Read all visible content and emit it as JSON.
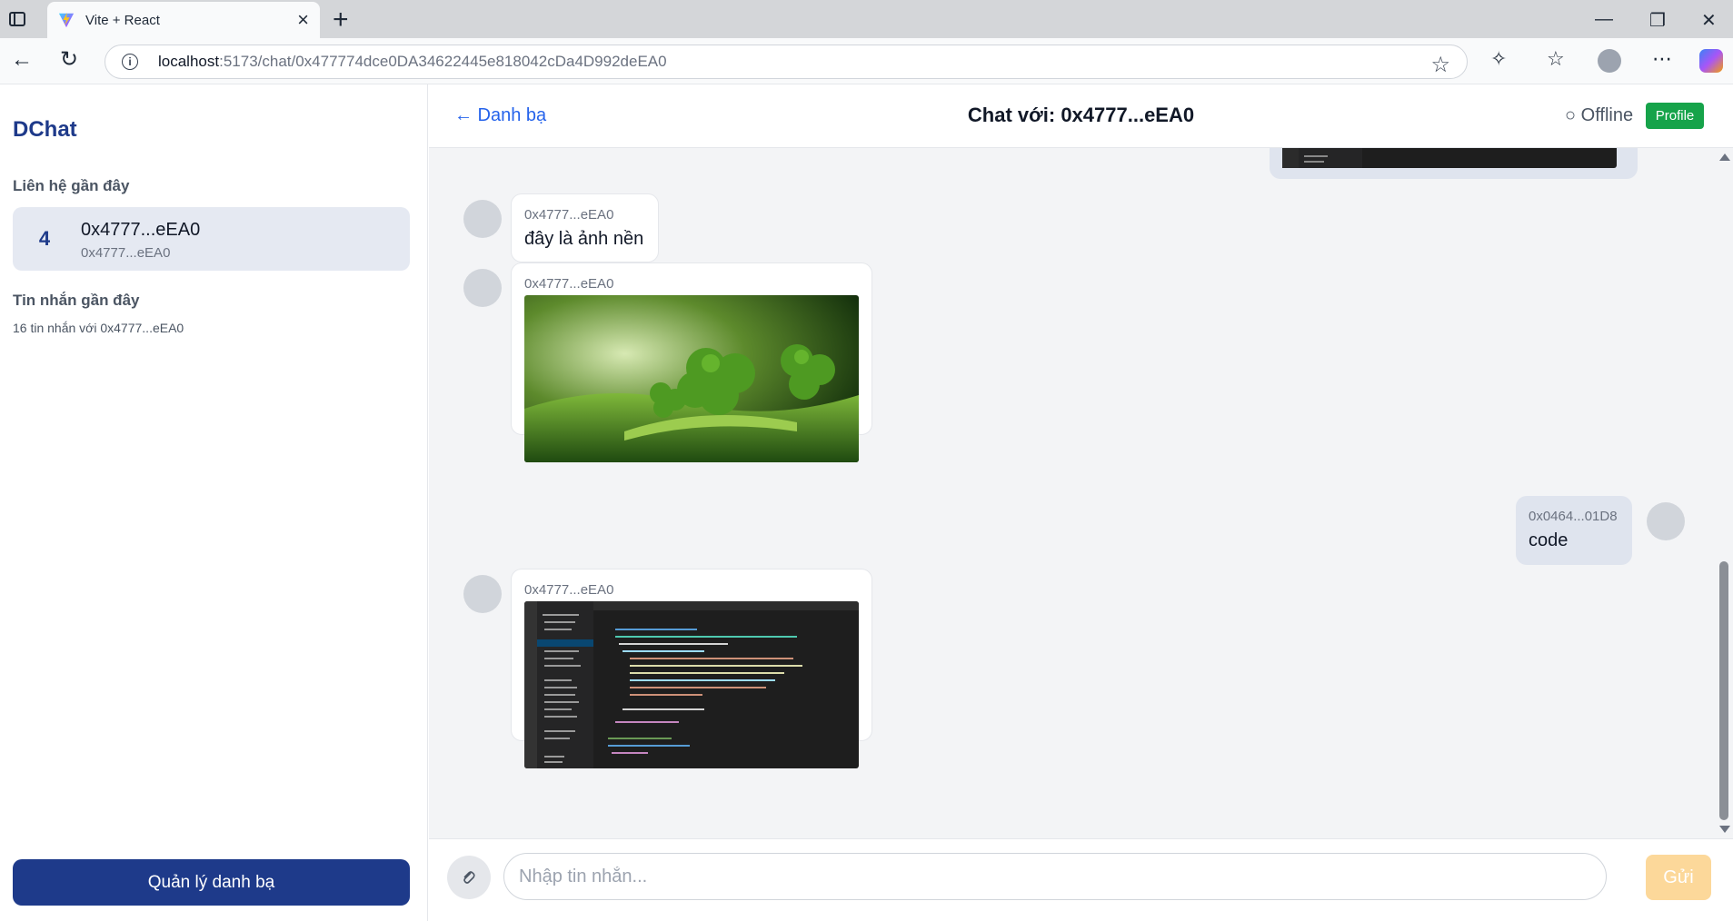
{
  "browser": {
    "tab_title": "Vite + React",
    "url_host": "localhost",
    "url_rest": ":5173/chat/0x477774dce0DA34622445e818042cDa4D992deEA0"
  },
  "sidebar": {
    "brand": "DChat",
    "recent_contacts_heading": "Liên hệ gần đây",
    "contacts": [
      {
        "badge": "4",
        "name": "0x4777...eEA0",
        "sub": "0x4777...eEA0"
      }
    ],
    "recent_messages_heading": "Tin nhắn gần đây",
    "recent_messages": [
      "16 tin nhắn với 0x4777...eEA0"
    ],
    "manage_button": "Quản lý danh bạ"
  },
  "chat": {
    "back_label": "← Danh bạ",
    "title": "Chat với: 0x4777...eEA0",
    "status": "○ Offline",
    "profile_button": "Profile",
    "messages": [
      {
        "sender": "0x4777...eEA0",
        "text": "đây là ảnh nền",
        "mine": false
      },
      {
        "sender": "0x4777...eEA0",
        "image": "clover-image",
        "mine": false
      },
      {
        "sender": "0x0464...01D8",
        "text": "code",
        "mine": true
      },
      {
        "sender": "0x4777...eEA0",
        "image": "code-screenshot-image",
        "mine": false
      }
    ],
    "input_placeholder": "Nhập tin nhắn...",
    "send_button": "Gửi"
  },
  "colors": {
    "brand": "#1e3a8a",
    "link": "#2563eb",
    "profile": "#16a34a",
    "send_disabled": "#fcd89a"
  }
}
